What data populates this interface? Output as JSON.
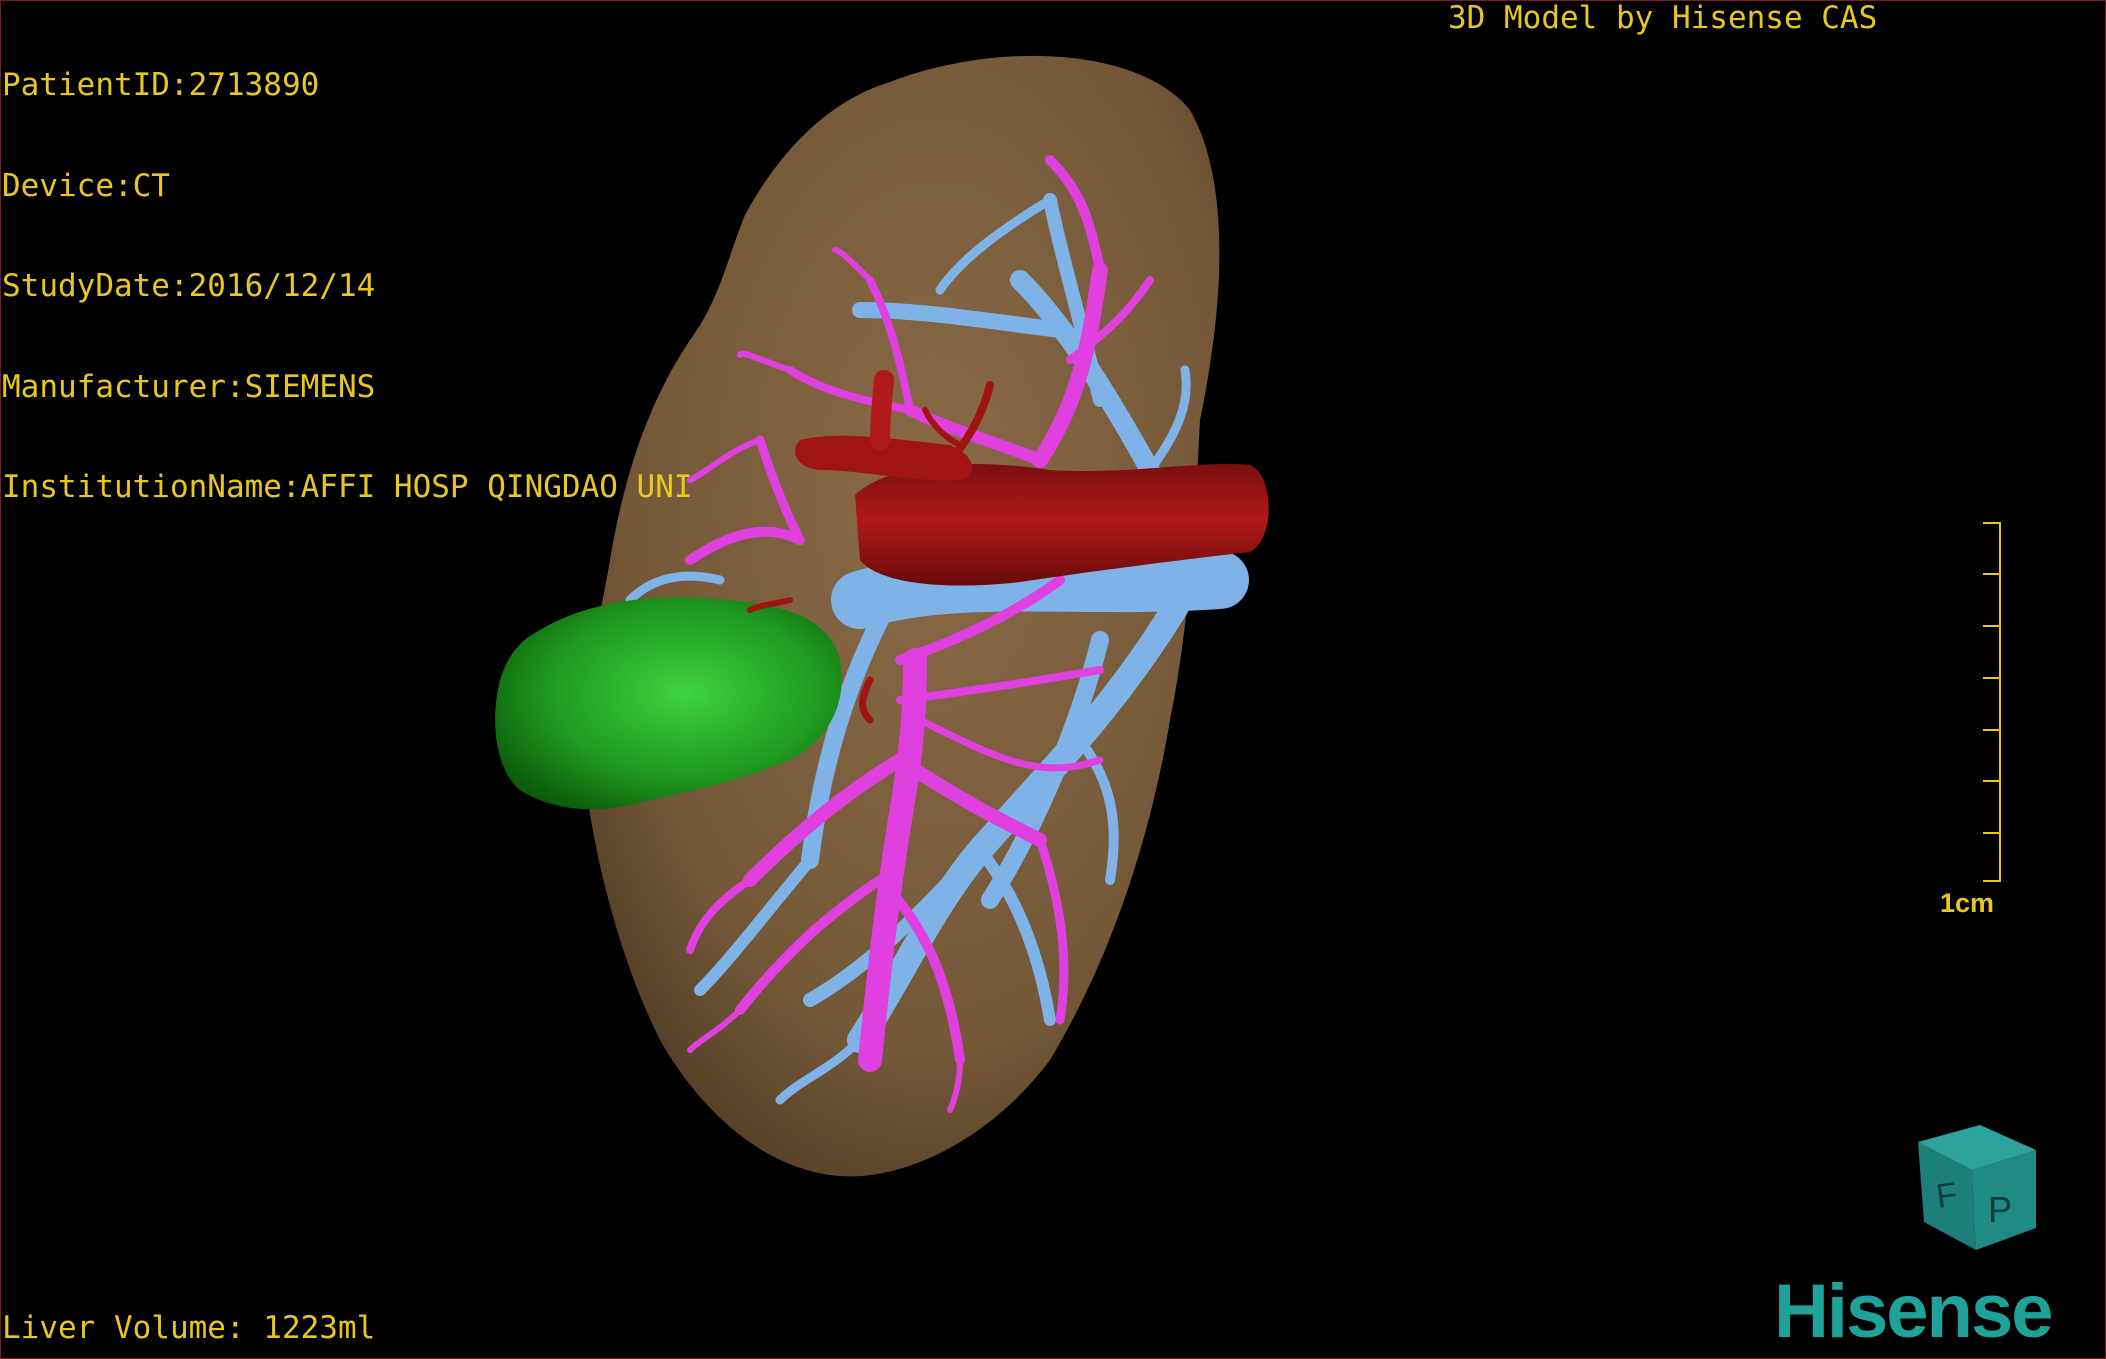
{
  "patient_info": {
    "patient_id": "PatientID:2713890",
    "device": "Device:CT",
    "study_date": "StudyDate:2016/12/14",
    "manufacturer": "Manufacturer:SIEMENS",
    "institution": "InstitutionName:AFFI HOSP QINGDAO UNI"
  },
  "credit": "3D Model by Hisense CAS",
  "liver_volume": "Liver Volume: 1223ml",
  "scale_bar": {
    "label": "1cm"
  },
  "orientation_cube": {
    "labels": [
      "F",
      "P"
    ],
    "color": "#1f8a86"
  },
  "brand": {
    "name": "Hisense",
    "color": "#1fa29a"
  },
  "model_colors": {
    "liver": "#7a5c3d",
    "portal_vein": "#7fb2e6",
    "hepatic_artery": "#a01414",
    "biliary": "#e040e0",
    "tumor": "#1f9a1f"
  }
}
